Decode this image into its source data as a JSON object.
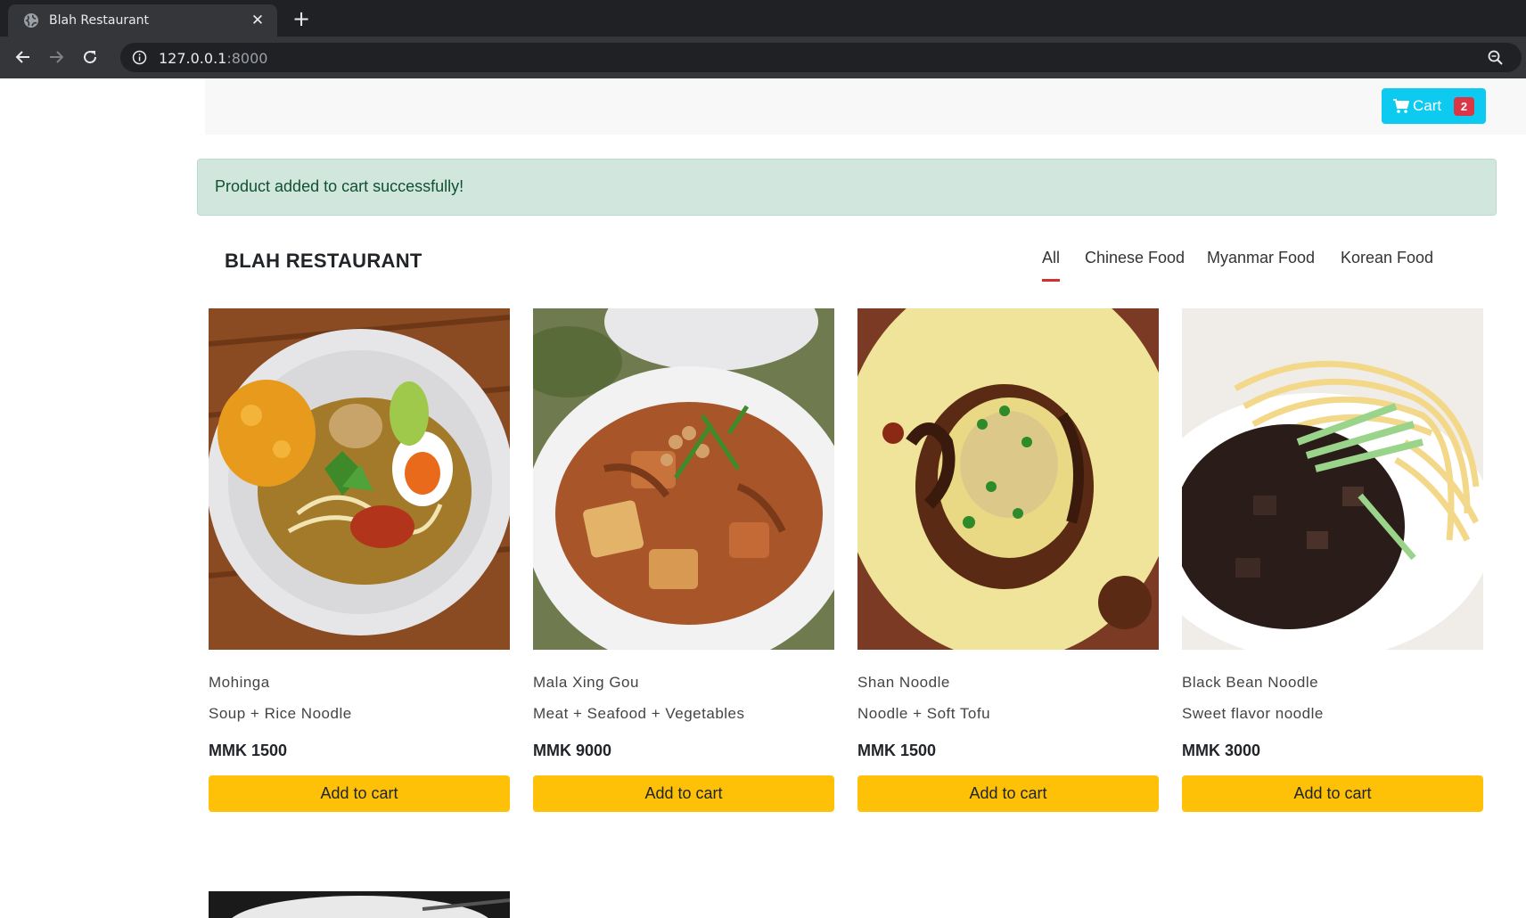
{
  "browser": {
    "tab_title": "Blah Restaurant",
    "tab_close": "✕",
    "new_tab": "+",
    "url_host": "127.0.0.1",
    "url_port": ":8000"
  },
  "nav": {
    "cart_label": "Cart",
    "cart_count": "2"
  },
  "alert": {
    "message": "Product added to cart successfully!"
  },
  "brand": "BLAH RESTAURANT",
  "filters": [
    "All",
    "Chinese Food",
    "Myanmar Food",
    "Korean Food"
  ],
  "products": [
    {
      "name": "Mohinga",
      "desc": "Soup + Rice Noodle",
      "price": "MMK 1500",
      "button": "Add to cart"
    },
    {
      "name": "Mala Xing Gou",
      "desc": "Meat + Seafood + Vegetables",
      "price": "MMK 9000",
      "button": "Add to cart"
    },
    {
      "name": "Shan Noodle",
      "desc": "Noodle + Soft Tofu",
      "price": "MMK 1500",
      "button": "Add to cart"
    },
    {
      "name": "Black Bean Noodle",
      "desc": "Sweet flavor noodle",
      "price": "MMK 3000",
      "button": "Add to cart"
    }
  ],
  "colors": {
    "cart_button": "#0dcaf0",
    "badge": "#dc3545",
    "alert_bg": "#d1e7dd",
    "add_button": "#ffc107",
    "active_filter_underline": "#d32f2f"
  }
}
